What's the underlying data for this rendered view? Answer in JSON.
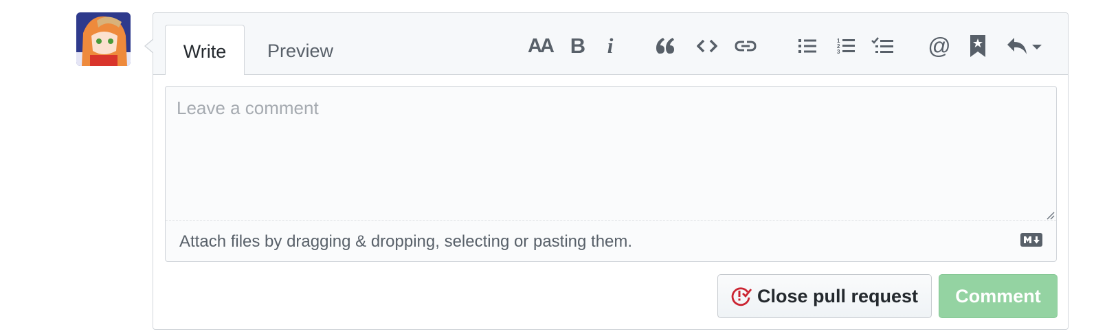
{
  "avatar": {
    "alt": "user avatar"
  },
  "editor": {
    "tabs": {
      "write": "Write",
      "preview": "Preview"
    },
    "toolbar": {
      "heading": "AA",
      "bold": "B",
      "italic": "i",
      "mention": "@"
    },
    "textarea": {
      "placeholder": "Leave a comment"
    },
    "attach_text": "Attach files by dragging & dropping, selecting or pasting them."
  },
  "actions": {
    "close_pr": "Close pull request",
    "comment": "Comment"
  },
  "colors": {
    "accent_red": "#cb2431",
    "comment_button_disabled": "#94d3a2"
  }
}
